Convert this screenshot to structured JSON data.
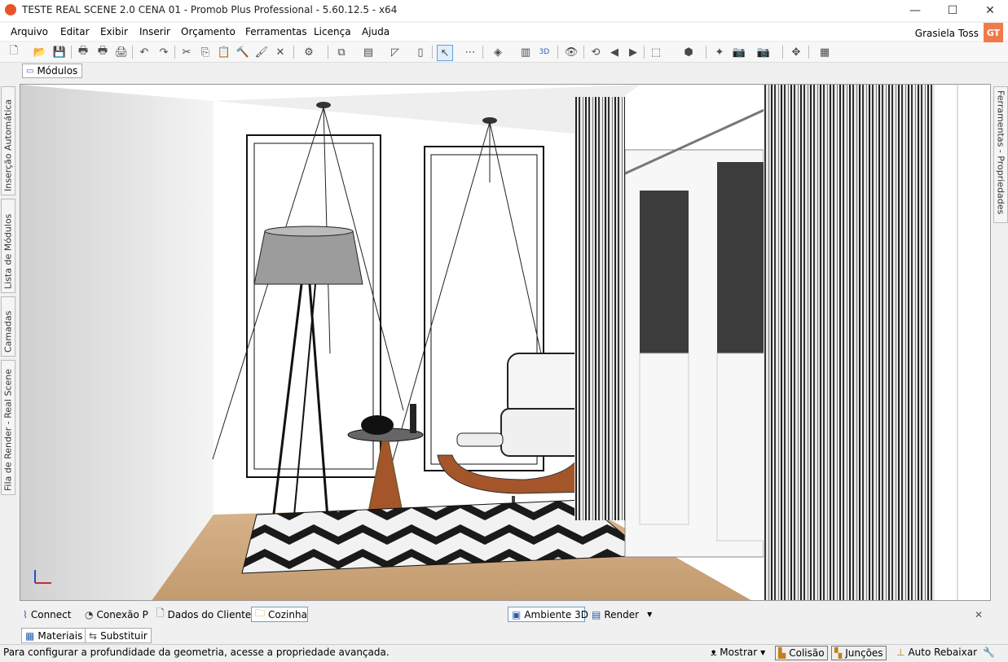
{
  "window": {
    "title": "TESTE REAL SCENE 2.0 CENA 01 - Promob Plus Professional - 5.60.12.5 - x64",
    "minimize_glyph": "—",
    "maximize_glyph": "☐",
    "close_glyph": "✕"
  },
  "menu": {
    "items": [
      "Arquivo",
      "Editar",
      "Exibir",
      "Inserir",
      "Orçamento",
      "Ferramentas",
      "Licença",
      "Ajuda"
    ],
    "user_name": "Grasiela Toss",
    "user_initials": "GT"
  },
  "toolbar": {
    "icons": [
      "new-file-icon",
      "open-folder-icon",
      "save-icon",
      "print-icon",
      "print-preview-icon",
      "printer-icon",
      "undo-icon",
      "redo-icon",
      "cut-icon",
      "copy-icon",
      "paste-icon",
      "hammer-icon",
      "paint-icon",
      "delete-icon",
      "render-sphere-icon",
      "group-icon",
      "layers-icon",
      "lasso-icon",
      "wall-icon",
      "select-arrow-icon",
      "measure-icon",
      "stack-icon",
      "book-icon",
      "3d-icon",
      "eye-icon",
      "rotate-icon",
      "back-icon",
      "forward-icon",
      "view-box-icon",
      "cube-icon",
      "light-icon",
      "camera-icon",
      "camera-settings-icon",
      "move-icon",
      "layout-icon"
    ]
  },
  "modules_tab": {
    "label": "Módulos"
  },
  "left_tabs": [
    "Inserção Automática",
    "Lista de Módulos",
    "Camadas",
    "Fila de Render - Real Scene"
  ],
  "right_tabs": [
    "Ferramentas - Propriedades"
  ],
  "bottom_tabs": {
    "left": [
      {
        "label": "Connect",
        "icon": "rss-icon"
      },
      {
        "label": "Conexão P",
        "icon": "promob-icon"
      },
      {
        "label": "Dados do Cliente",
        "icon": "document-icon"
      },
      {
        "label": "Cozinha",
        "icon": "folder-icon",
        "active": true
      }
    ],
    "center": [
      {
        "label": "Ambiente 3D",
        "icon": "monitor-icon",
        "active": true
      },
      {
        "label": "Render",
        "icon": "render-icon"
      }
    ],
    "close_glyph": "✕"
  },
  "material_tabs": [
    {
      "label": "Materiais",
      "icon": "materials-icon"
    },
    {
      "label": "Substituir",
      "icon": "replace-icon"
    }
  ],
  "status": {
    "message": "Para configurar a profundidade da geometria, acesse a propriedade avançada.",
    "mostrar": "Mostrar",
    "colisao": "Colisão",
    "juncoes": "Junções",
    "auto_rebaixar": "Auto Rebaixar"
  },
  "scene": {
    "wall_color": "#ffffff",
    "floor_color": "#c9a37a",
    "chair_shell_color": "#a5552a"
  }
}
